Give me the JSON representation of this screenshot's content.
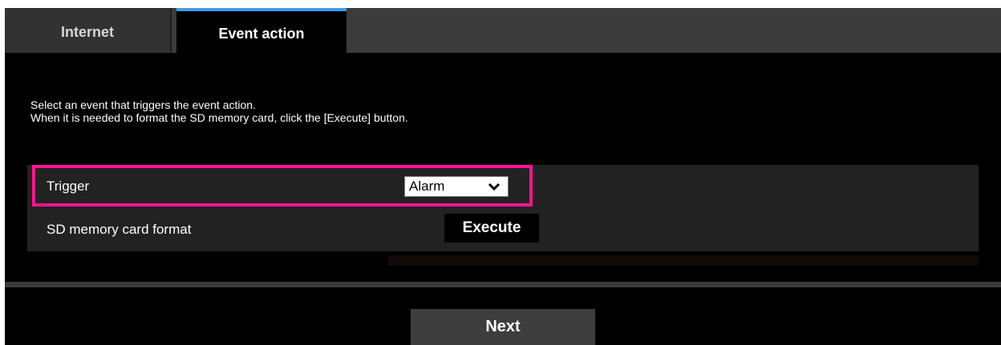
{
  "tabs": [
    {
      "label": "Internet",
      "active": false
    },
    {
      "label": "Event action",
      "active": true
    }
  ],
  "description": {
    "line1": "Select an event that triggers the event action.",
    "line2": "When it is needed to format the SD memory card, click the [Execute] button."
  },
  "settings": {
    "trigger": {
      "label": "Trigger",
      "selected": "Alarm",
      "dropdown_icon": "chevron-down-icon"
    },
    "sd_format": {
      "label": "SD memory card format",
      "button": "Execute"
    }
  },
  "footer": {
    "next_label": "Next"
  },
  "colors": {
    "accent": "#3e9de8",
    "highlight": "#ff1493",
    "background": "#000000"
  }
}
